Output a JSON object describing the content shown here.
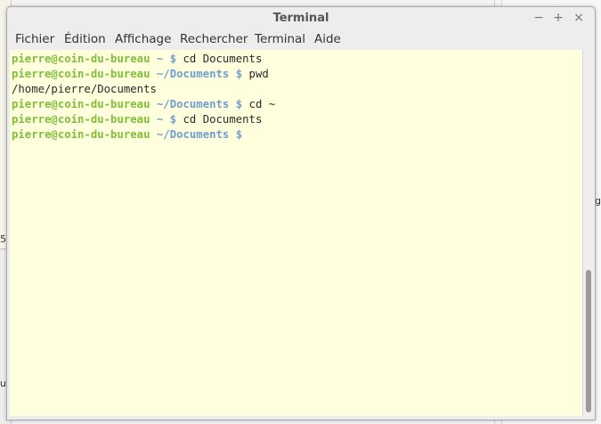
{
  "background": {
    "frag_left_1": "5",
    "frag_left_2": "us",
    "frag_right_1": "g"
  },
  "window": {
    "title": "Terminal",
    "controls": {
      "minimize": "−",
      "maximize": "+",
      "close": "×"
    }
  },
  "menu": {
    "items": [
      "Fichier",
      "Édition",
      "Affichage",
      "Rechercher",
      "Terminal",
      "Aide"
    ]
  },
  "terminal": {
    "prompt_user": "pierre@coin-du-bureau",
    "lines": [
      {
        "path": " ~ ",
        "sym": "$",
        "cmd": " cd Documents"
      },
      {
        "path": " ~/Documents ",
        "sym": "$",
        "cmd": " pwd"
      },
      {
        "output": "/home/pierre/Documents"
      },
      {
        "path": " ~/Documents ",
        "sym": "$",
        "cmd": " cd ~"
      },
      {
        "path": " ~ ",
        "sym": "$",
        "cmd": " cd Documents"
      },
      {
        "path": " ~/Documents ",
        "sym": "$",
        "cmd": ""
      }
    ]
  },
  "colors": {
    "user": "#7fbf3a",
    "path": "#6f9fcf",
    "background": "#ffffdd"
  },
  "icons": {
    "minimize": "minimize-icon",
    "maximize": "maximize-icon",
    "close": "close-icon"
  }
}
